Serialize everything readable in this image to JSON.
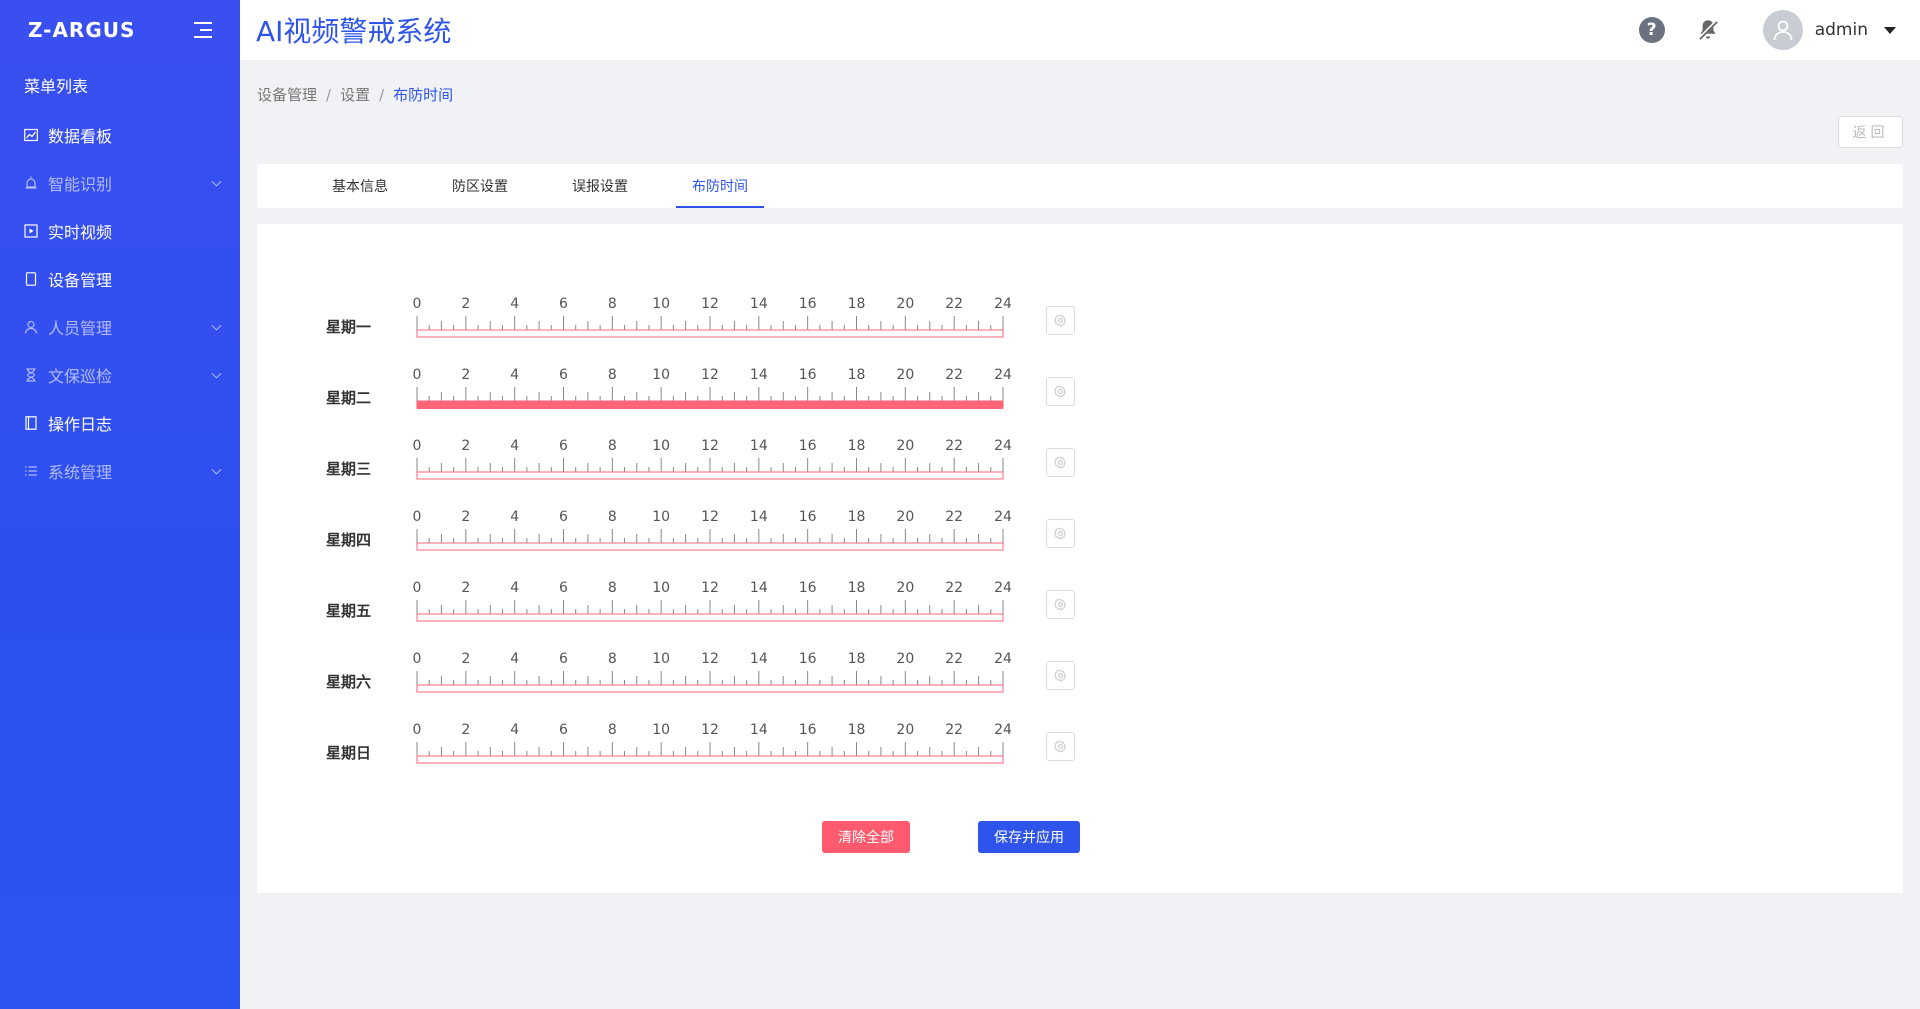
{
  "sidebar": {
    "logo": "Z-ARGUS",
    "menu_header": "菜单列表",
    "items": [
      {
        "label": "数据看板",
        "icon": "chart-line-icon",
        "dim": false,
        "expandable": false
      },
      {
        "label": "智能识别",
        "icon": "alarm-icon",
        "dim": true,
        "expandable": true
      },
      {
        "label": "实时视频",
        "icon": "play-square-icon",
        "dim": false,
        "expandable": false
      },
      {
        "label": "设备管理",
        "icon": "device-icon",
        "dim": false,
        "expandable": false
      },
      {
        "label": "人员管理",
        "icon": "user-icon",
        "dim": true,
        "expandable": true
      },
      {
        "label": "文保巡检",
        "icon": "hourglass-icon",
        "dim": true,
        "expandable": true
      },
      {
        "label": "操作日志",
        "icon": "log-book-icon",
        "dim": false,
        "expandable": false
      },
      {
        "label": "系统管理",
        "icon": "list-icon",
        "dim": true,
        "expandable": true
      }
    ]
  },
  "header": {
    "title": "AI视频警戒系统",
    "help_icon": "?",
    "username": "admin"
  },
  "breadcrumb": [
    "设备管理",
    "设置",
    "布防时间"
  ],
  "back_button": "返回",
  "tabs": [
    {
      "label": "基本信息",
      "active": false
    },
    {
      "label": "防区设置",
      "active": false
    },
    {
      "label": "误报设置",
      "active": false
    },
    {
      "label": "布防时间",
      "active": true
    }
  ],
  "schedule": {
    "tick_labels": [
      "0",
      "2",
      "4",
      "6",
      "8",
      "10",
      "12",
      "14",
      "16",
      "18",
      "20",
      "22",
      "24"
    ],
    "hours_total": 24,
    "days": [
      {
        "label": "星期一",
        "armed": []
      },
      {
        "label": "星期二",
        "armed": [
          [
            0,
            24
          ]
        ]
      },
      {
        "label": "星期三",
        "armed": []
      },
      {
        "label": "星期四",
        "armed": []
      },
      {
        "label": "星期五",
        "armed": []
      },
      {
        "label": "星期六",
        "armed": []
      },
      {
        "label": "星期日",
        "armed": []
      }
    ]
  },
  "buttons": {
    "clear_all": "清除全部",
    "save_apply": "保存并应用"
  },
  "colors": {
    "accent": "#2f54eb",
    "armed_fill": "#ff6477",
    "ruler": "#ff6477",
    "clear_button": "#ff5a6e"
  }
}
